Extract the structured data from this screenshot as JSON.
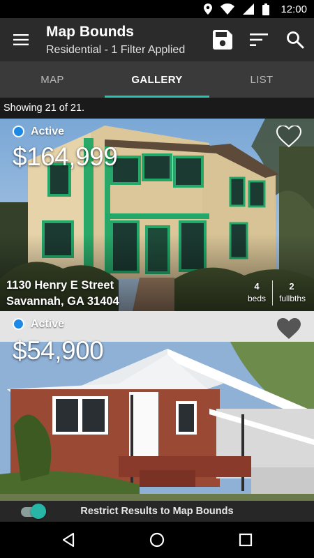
{
  "status_bar": {
    "time": "12:00",
    "icons": [
      "location-icon",
      "wifi-icon",
      "signal-icon",
      "battery-icon"
    ]
  },
  "app_bar": {
    "title": "Map Bounds",
    "subtitle": "Residential - 1 Filter Applied",
    "icons": [
      "menu-icon",
      "save-icon",
      "sort-icon",
      "search-icon"
    ]
  },
  "tabs": [
    {
      "label": "MAP",
      "active": false
    },
    {
      "label": "GALLERY",
      "active": true
    },
    {
      "label": "LIST",
      "active": false
    }
  ],
  "results": {
    "showing_text": "Showing 21 of 21."
  },
  "listings": [
    {
      "status": "Active",
      "price": "$164,999",
      "address_line1": "1130 Henry E Street",
      "address_line2": "Savannah, GA 31404",
      "beds_value": "4",
      "beds_label": "beds",
      "baths_value": "2",
      "baths_label": "fullbths",
      "favorited": false
    },
    {
      "status": "Active",
      "price": "$54,900",
      "favorited": false
    }
  ],
  "map_bounds_toggle": {
    "label": "Restrict Results to Map Bounds",
    "enabled": true
  },
  "colors": {
    "accent": "#26c6b4",
    "status_active": "#1e88e5",
    "app_bar": "#2b2b2b",
    "tab_bar": "#3a3a3a"
  },
  "nav_bar": {
    "icons": [
      "back-icon",
      "home-icon",
      "recents-icon"
    ]
  }
}
